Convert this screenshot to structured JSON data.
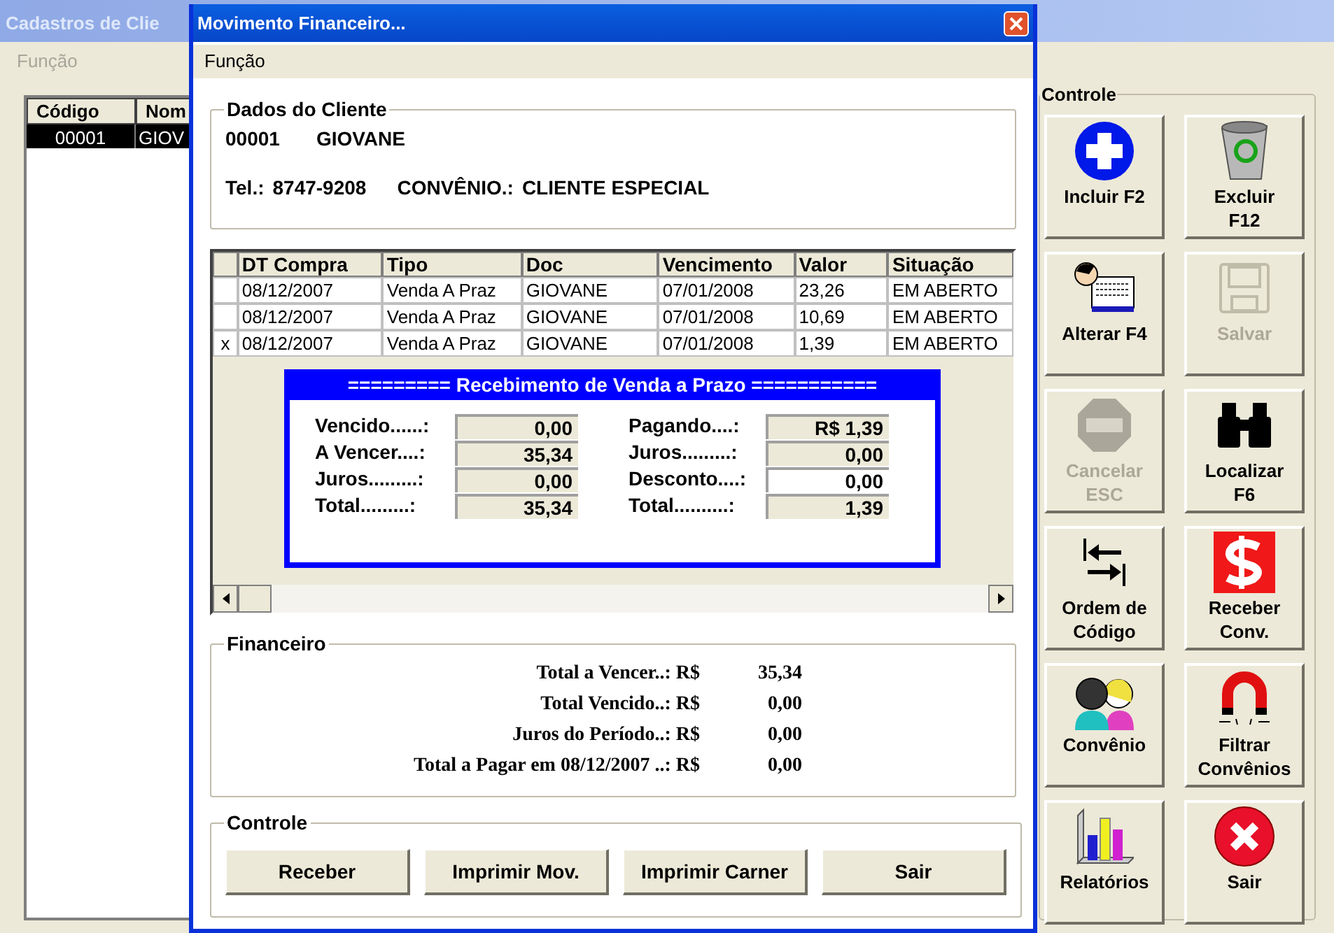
{
  "background_window": {
    "title": "Cadastros de Clie",
    "menu": [
      "Função"
    ],
    "list": {
      "columns": [
        "Código",
        "Nom"
      ],
      "rows": [
        {
          "cells": [
            "00001",
            "GIOV"
          ],
          "selected": true
        }
      ]
    },
    "controls": {
      "title": "Controle",
      "buttons": [
        {
          "lines": [
            "Incluir F2"
          ],
          "disabled": false
        },
        {
          "lines": [
            "Excluir",
            "F12"
          ],
          "disabled": false
        },
        {
          "lines": [
            "Alterar F4"
          ],
          "disabled": false
        },
        {
          "lines": [
            "Salvar"
          ],
          "disabled": true
        },
        {
          "lines": [
            "Cancelar",
            "ESC"
          ],
          "disabled": true
        },
        {
          "lines": [
            "Localizar",
            "F6"
          ],
          "disabled": false
        },
        {
          "lines": [
            "Ordem de",
            "Código"
          ],
          "disabled": false
        },
        {
          "lines": [
            "Receber",
            "Conv."
          ],
          "disabled": false
        },
        {
          "lines": [
            "Convênio"
          ],
          "disabled": false
        },
        {
          "lines": [
            "Filtrar",
            "Convênios"
          ],
          "disabled": false
        },
        {
          "lines": [
            "Relatórios"
          ],
          "disabled": false
        },
        {
          "lines": [
            "Sair"
          ],
          "disabled": false
        }
      ]
    }
  },
  "dialog": {
    "title": "Movimento Financeiro...",
    "menu": [
      "Função"
    ],
    "client": {
      "title": "Dados do Cliente",
      "code": "00001",
      "name": "GIOVANE",
      "phone_label": "Tel.:",
      "phone": "8747-9208",
      "agreement_label": "CONVÊNIO.:",
      "agreement": "CLIENTE ESPECIAL"
    },
    "grid": {
      "columns": [
        "DT Compra",
        "Tipo",
        "Doc",
        "Vencimento",
        "Valor",
        "Situação"
      ],
      "rows": [
        {
          "marker": "",
          "cells": [
            "08/12/2007",
            "Venda A Praz",
            "GIOVANE",
            "07/01/2008",
            "23,26",
            "EM ABERTO"
          ]
        },
        {
          "marker": "",
          "cells": [
            "08/12/2007",
            "Venda A Praz",
            "GIOVANE",
            "07/01/2008",
            "10,69",
            "EM ABERTO"
          ]
        },
        {
          "marker": "x",
          "cells": [
            "08/12/2007",
            "Venda A Praz",
            "GIOVANE",
            "07/01/2008",
            "1,39",
            "EM ABERTO"
          ]
        }
      ]
    },
    "receipt": {
      "title": "========= Recebimento de Venda a Prazo ===========",
      "left": [
        {
          "label": "Vencido......:",
          "value": "0,00",
          "editable": false
        },
        {
          "label": "A Vencer....:",
          "value": "35,34",
          "editable": false
        },
        {
          "label": "Juros.........:",
          "value": "0,00",
          "editable": false
        },
        {
          "label": "Total.........:",
          "value": "35,34",
          "editable": false
        }
      ],
      "right": [
        {
          "label": "Pagando....:",
          "value": "R$ 1,39",
          "editable": false
        },
        {
          "label": "Juros.........:",
          "value": "0,00",
          "editable": false
        },
        {
          "label": "Desconto....:",
          "value": "0,00",
          "editable": true
        },
        {
          "label": "Total..........:",
          "value": "1,39",
          "editable": false
        }
      ]
    },
    "financial": {
      "title": "Financeiro",
      "rows": [
        {
          "label": "Total a Vencer..: R$",
          "value": "35,34"
        },
        {
          "label": "Total Vencido..: R$",
          "value": "0,00"
        },
        {
          "label": "Juros do Período..: R$",
          "value": "0,00"
        },
        {
          "label": "Total a Pagar em 08/12/2007 ..: R$",
          "value": "0,00"
        }
      ]
    },
    "controls": {
      "title": "Controle",
      "buttons": [
        "Receber",
        "Imprimir Mov.",
        "Imprimir Carner",
        "Sair"
      ]
    }
  }
}
